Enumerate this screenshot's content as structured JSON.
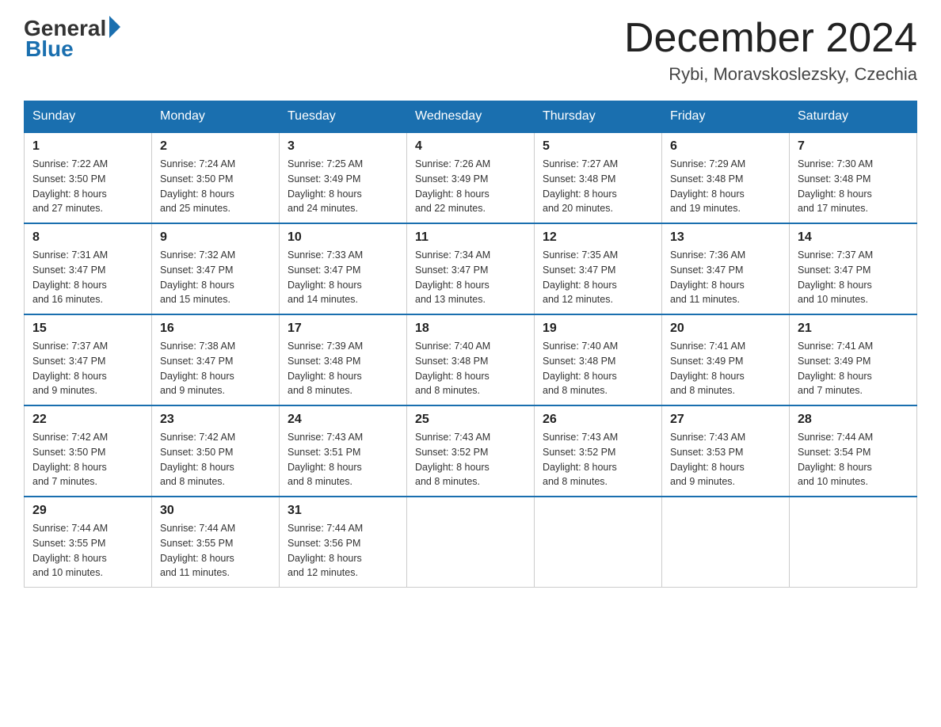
{
  "logo": {
    "general": "General",
    "blue": "Blue"
  },
  "header": {
    "month_title": "December 2024",
    "location": "Rybi, Moravskoslezsky, Czechia"
  },
  "weekdays": [
    "Sunday",
    "Monday",
    "Tuesday",
    "Wednesday",
    "Thursday",
    "Friday",
    "Saturday"
  ],
  "weeks": [
    [
      {
        "day": "1",
        "sunrise": "7:22 AM",
        "sunset": "3:50 PM",
        "daylight": "8 hours and 27 minutes."
      },
      {
        "day": "2",
        "sunrise": "7:24 AM",
        "sunset": "3:50 PM",
        "daylight": "8 hours and 25 minutes."
      },
      {
        "day": "3",
        "sunrise": "7:25 AM",
        "sunset": "3:49 PM",
        "daylight": "8 hours and 24 minutes."
      },
      {
        "day": "4",
        "sunrise": "7:26 AM",
        "sunset": "3:49 PM",
        "daylight": "8 hours and 22 minutes."
      },
      {
        "day": "5",
        "sunrise": "7:27 AM",
        "sunset": "3:48 PM",
        "daylight": "8 hours and 20 minutes."
      },
      {
        "day": "6",
        "sunrise": "7:29 AM",
        "sunset": "3:48 PM",
        "daylight": "8 hours and 19 minutes."
      },
      {
        "day": "7",
        "sunrise": "7:30 AM",
        "sunset": "3:48 PM",
        "daylight": "8 hours and 17 minutes."
      }
    ],
    [
      {
        "day": "8",
        "sunrise": "7:31 AM",
        "sunset": "3:47 PM",
        "daylight": "8 hours and 16 minutes."
      },
      {
        "day": "9",
        "sunrise": "7:32 AM",
        "sunset": "3:47 PM",
        "daylight": "8 hours and 15 minutes."
      },
      {
        "day": "10",
        "sunrise": "7:33 AM",
        "sunset": "3:47 PM",
        "daylight": "8 hours and 14 minutes."
      },
      {
        "day": "11",
        "sunrise": "7:34 AM",
        "sunset": "3:47 PM",
        "daylight": "8 hours and 13 minutes."
      },
      {
        "day": "12",
        "sunrise": "7:35 AM",
        "sunset": "3:47 PM",
        "daylight": "8 hours and 12 minutes."
      },
      {
        "day": "13",
        "sunrise": "7:36 AM",
        "sunset": "3:47 PM",
        "daylight": "8 hours and 11 minutes."
      },
      {
        "day": "14",
        "sunrise": "7:37 AM",
        "sunset": "3:47 PM",
        "daylight": "8 hours and 10 minutes."
      }
    ],
    [
      {
        "day": "15",
        "sunrise": "7:37 AM",
        "sunset": "3:47 PM",
        "daylight": "8 hours and 9 minutes."
      },
      {
        "day": "16",
        "sunrise": "7:38 AM",
        "sunset": "3:47 PM",
        "daylight": "8 hours and 9 minutes."
      },
      {
        "day": "17",
        "sunrise": "7:39 AM",
        "sunset": "3:48 PM",
        "daylight": "8 hours and 8 minutes."
      },
      {
        "day": "18",
        "sunrise": "7:40 AM",
        "sunset": "3:48 PM",
        "daylight": "8 hours and 8 minutes."
      },
      {
        "day": "19",
        "sunrise": "7:40 AM",
        "sunset": "3:48 PM",
        "daylight": "8 hours and 8 minutes."
      },
      {
        "day": "20",
        "sunrise": "7:41 AM",
        "sunset": "3:49 PM",
        "daylight": "8 hours and 8 minutes."
      },
      {
        "day": "21",
        "sunrise": "7:41 AM",
        "sunset": "3:49 PM",
        "daylight": "8 hours and 7 minutes."
      }
    ],
    [
      {
        "day": "22",
        "sunrise": "7:42 AM",
        "sunset": "3:50 PM",
        "daylight": "8 hours and 7 minutes."
      },
      {
        "day": "23",
        "sunrise": "7:42 AM",
        "sunset": "3:50 PM",
        "daylight": "8 hours and 8 minutes."
      },
      {
        "day": "24",
        "sunrise": "7:43 AM",
        "sunset": "3:51 PM",
        "daylight": "8 hours and 8 minutes."
      },
      {
        "day": "25",
        "sunrise": "7:43 AM",
        "sunset": "3:52 PM",
        "daylight": "8 hours and 8 minutes."
      },
      {
        "day": "26",
        "sunrise": "7:43 AM",
        "sunset": "3:52 PM",
        "daylight": "8 hours and 8 minutes."
      },
      {
        "day": "27",
        "sunrise": "7:43 AM",
        "sunset": "3:53 PM",
        "daylight": "8 hours and 9 minutes."
      },
      {
        "day": "28",
        "sunrise": "7:44 AM",
        "sunset": "3:54 PM",
        "daylight": "8 hours and 10 minutes."
      }
    ],
    [
      {
        "day": "29",
        "sunrise": "7:44 AM",
        "sunset": "3:55 PM",
        "daylight": "8 hours and 10 minutes."
      },
      {
        "day": "30",
        "sunrise": "7:44 AM",
        "sunset": "3:55 PM",
        "daylight": "8 hours and 11 minutes."
      },
      {
        "day": "31",
        "sunrise": "7:44 AM",
        "sunset": "3:56 PM",
        "daylight": "8 hours and 12 minutes."
      },
      null,
      null,
      null,
      null
    ]
  ],
  "labels": {
    "sunrise": "Sunrise:",
    "sunset": "Sunset:",
    "daylight": "Daylight:"
  }
}
